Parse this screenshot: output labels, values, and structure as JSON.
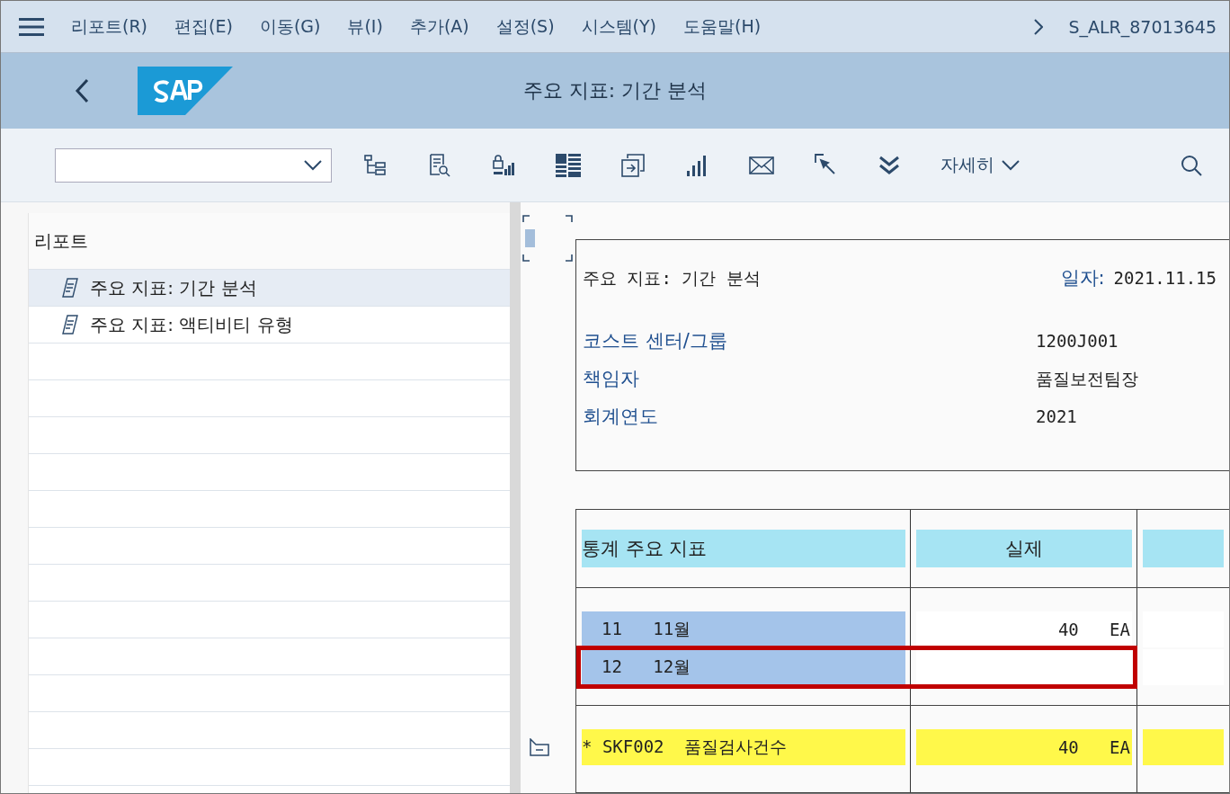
{
  "menu_bar": {
    "items": [
      "리포트(R)",
      "편집(E)",
      "이동(G)",
      "뷰(I)",
      "추가(A)",
      "설정(S)",
      "시스템(Y)",
      "도움말(H)"
    ],
    "transaction": "S_ALR_87013645"
  },
  "header": {
    "title": "주요 지표: 기간 분석"
  },
  "toolbar": {
    "more_label": "자세히"
  },
  "report_tree": {
    "title": "리포트",
    "items": [
      {
        "label": "주요 지표: 기간 분석",
        "selected": true
      },
      {
        "label": "주요 지표: 액티비티 유형",
        "selected": false
      }
    ]
  },
  "report": {
    "title": "주요 지표: 기간 분석",
    "date_label": "일자:",
    "date": "2021.11.15",
    "fields": [
      {
        "label": "코스트 센터/그룹",
        "value": "1200J001"
      },
      {
        "label": "책임자",
        "value": "품질보전팀장"
      },
      {
        "label": "회계연도",
        "value": "2021"
      }
    ]
  },
  "table": {
    "columns": [
      "통계 주요 지표",
      "실제"
    ],
    "rows": [
      {
        "kind": "period",
        "code": "11",
        "name": "11월",
        "actual": "40",
        "unit": "EA",
        "highlighted": false
      },
      {
        "kind": "period",
        "code": "12",
        "name": "12월",
        "highlighted": true
      },
      {
        "kind": "total",
        "code": "* SKF002",
        "name": "품질검사건수",
        "actual": "40",
        "unit": "EA",
        "highlighted": false
      }
    ]
  }
}
